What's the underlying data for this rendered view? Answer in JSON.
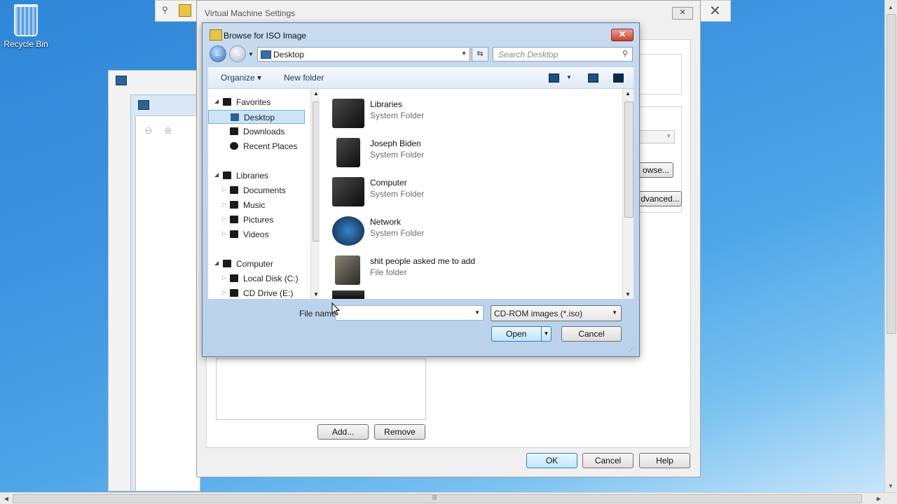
{
  "desktop": {
    "recycle_bin_label": "Recycle Bin"
  },
  "vm_settings": {
    "title": "Virtual Machine Settings",
    "close_label": "✕",
    "browse_partial_label": "owse...",
    "advanced_partial_label": "dvanced...",
    "add_label": "Add...",
    "remove_label": "Remove",
    "ok_label": "OK",
    "cancel_label": "Cancel",
    "help_label": "Help"
  },
  "dialog": {
    "title": "Browse for ISO Image",
    "close_label": "✕",
    "address": "Desktop",
    "search_placeholder": "Search Desktop",
    "organize_label": "Organize ▾",
    "new_folder_label": "New folder",
    "nav": {
      "favorites": "Favorites",
      "desktop": "Desktop",
      "downloads": "Downloads",
      "recent_places": "Recent Places",
      "libraries": "Libraries",
      "documents": "Documents",
      "music": "Music",
      "pictures": "Pictures",
      "videos": "Videos",
      "computer": "Computer",
      "local_disk": "Local Disk (C:)",
      "cd_drive": "CD Drive (E:)"
    },
    "files": [
      {
        "name": "Libraries",
        "type": "System Folder"
      },
      {
        "name": "Joseph Biden",
        "type": "System Folder"
      },
      {
        "name": "Computer",
        "type": "System Folder"
      },
      {
        "name": "Network",
        "type": "System Folder"
      },
      {
        "name": "shit people asked me to add",
        "type": "File folder"
      }
    ],
    "file_name_label": "File name:",
    "file_name_value": "",
    "file_type": "CD-ROM images (*.iso)",
    "open_label": "Open",
    "cancel_label": "Cancel"
  },
  "scrollbar": {
    "grip": "|||"
  }
}
